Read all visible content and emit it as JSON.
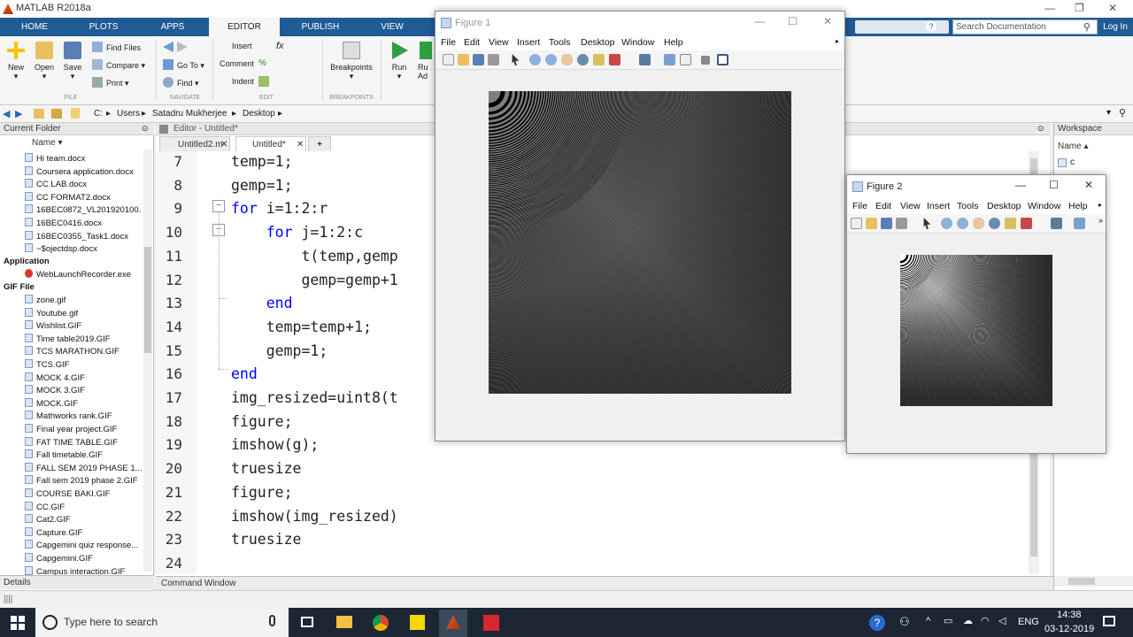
{
  "window": {
    "title": "MATLAB R2018a"
  },
  "ribbon_tabs": [
    "HOME",
    "PLOTS",
    "APPS",
    "EDITOR",
    "PUBLISH",
    "VIEW"
  ],
  "ribbon": {
    "new": "New",
    "open": "Open",
    "save": "Save",
    "find_files": "Find Files",
    "compare": "Compare",
    "print": "Print",
    "go_to": "Go To",
    "find": "Find",
    "insert": "Insert",
    "comment": "Comment",
    "indent": "Indent",
    "breakpoints": "Breakpoints",
    "run": "Run",
    "run_adv_fragment": "Ru\nAd",
    "group_file": "FILE",
    "group_navigate": "NAVIGATE",
    "group_edit": "EDIT",
    "group_breakpoints": "BREAKPOINTS"
  },
  "search": {
    "placeholder": "Search Documentation",
    "login": "Log In"
  },
  "address": {
    "crumbs": [
      "C:",
      "Users",
      "Satadru Mukherjee",
      "Desktop"
    ]
  },
  "current_folder": {
    "title": "Current Folder",
    "column": "Name ▾",
    "files_top": [
      "Hi team.docx",
      "Coursera application.docx",
      "CC LAB.docx",
      "CC FORMAT2.docx",
      "16BEC0872_VL201920100...",
      "16BEC0416.docx",
      "16BEC0355_Task1.docx",
      "~$ojectdsp.docx"
    ],
    "group_app": "Application",
    "files_app": [
      "WebLaunchRecorder.exe"
    ],
    "group_gif": "GIF File",
    "files_gif": [
      "zone.gif",
      "Youtube.gif",
      "Wishlist.GIF",
      "Time table2019.GIF",
      "TCS MARATHON.GIF",
      "TCS.GIF",
      "MOCK 4.GIF",
      "MOCK 3.GIF",
      "MOCK.GIF",
      "Mathworks rank.GIF",
      "Final year project.GIF",
      "FAT TIME TABLE.GIF",
      "Fall timetable.GIF",
      "FALL SEM 2019 PHASE 1...",
      "Fall sem 2019 phase 2.GIF",
      "COURSE BAKI.GIF",
      "CC.GIF",
      "Cat2.GIF",
      "Capture.GIF",
      "Capgemini quiz response...",
      "Capgemini.GIF",
      "Campus interaction.GIF"
    ]
  },
  "details": "Details",
  "editor": {
    "header": "Editor - Untitled*",
    "tabs": [
      "Untitled2.m",
      "Untitled*"
    ],
    "lines": [
      {
        "n": "7",
        "pre": "temp=1;",
        "kw": "",
        "post": ""
      },
      {
        "n": "8",
        "pre": "gemp=1;",
        "kw": "",
        "post": ""
      },
      {
        "n": "9",
        "pre": "",
        "kw": "for",
        "post": " i=1:2:r"
      },
      {
        "n": "10",
        "pre": "    ",
        "kw": "for",
        "post": " j=1:2:c"
      },
      {
        "n": "11",
        "pre": "        t(temp,gemp",
        "kw": "",
        "post": ""
      },
      {
        "n": "12",
        "pre": "        gemp=gemp+1",
        "kw": "",
        "post": ""
      },
      {
        "n": "13",
        "pre": "    ",
        "kw": "end",
        "post": ""
      },
      {
        "n": "14",
        "pre": "    temp=temp+1;",
        "kw": "",
        "post": ""
      },
      {
        "n": "15",
        "pre": "    gemp=1;",
        "kw": "",
        "post": ""
      },
      {
        "n": "16",
        "pre": "",
        "kw": "end",
        "post": ""
      },
      {
        "n": "17",
        "pre": "img_resized=uint8(t",
        "kw": "",
        "post": ""
      },
      {
        "n": "18",
        "pre": "figure;",
        "kw": "",
        "post": ""
      },
      {
        "n": "19",
        "pre": "imshow(g);",
        "kw": "",
        "post": ""
      },
      {
        "n": "20",
        "pre": "truesize",
        "kw": "",
        "post": ""
      },
      {
        "n": "21",
        "pre": "figure;",
        "kw": "",
        "post": ""
      },
      {
        "n": "22",
        "pre": "imshow(img_resized)",
        "kw": "",
        "post": ""
      },
      {
        "n": "23",
        "pre": "truesize",
        "kw": "",
        "post": ""
      },
      {
        "n": "24",
        "pre": "",
        "kw": "",
        "post": ""
      }
    ]
  },
  "workspace": {
    "title": "Workspace",
    "column": "Name ▴",
    "vars": [
      "c"
    ]
  },
  "command_window": "Command Window",
  "figure1": {
    "title": "Figure 1",
    "menu": [
      "File",
      "Edit",
      "View",
      "Insert",
      "Tools",
      "Desktop",
      "Window",
      "Help"
    ]
  },
  "figure2": {
    "title": "Figure 2",
    "menu": [
      "File",
      "Edit",
      "View",
      "Insert",
      "Tools",
      "Desktop",
      "Window",
      "Help"
    ]
  },
  "taskbar": {
    "search_placeholder": "Type here to search",
    "language": "ENG",
    "time": "14:38",
    "date": "03-12-2019"
  },
  "colors": {
    "ribbon_blue": "#1f5b95",
    "keyword_blue": "#0000ff",
    "taskbar": "#1d2733"
  }
}
